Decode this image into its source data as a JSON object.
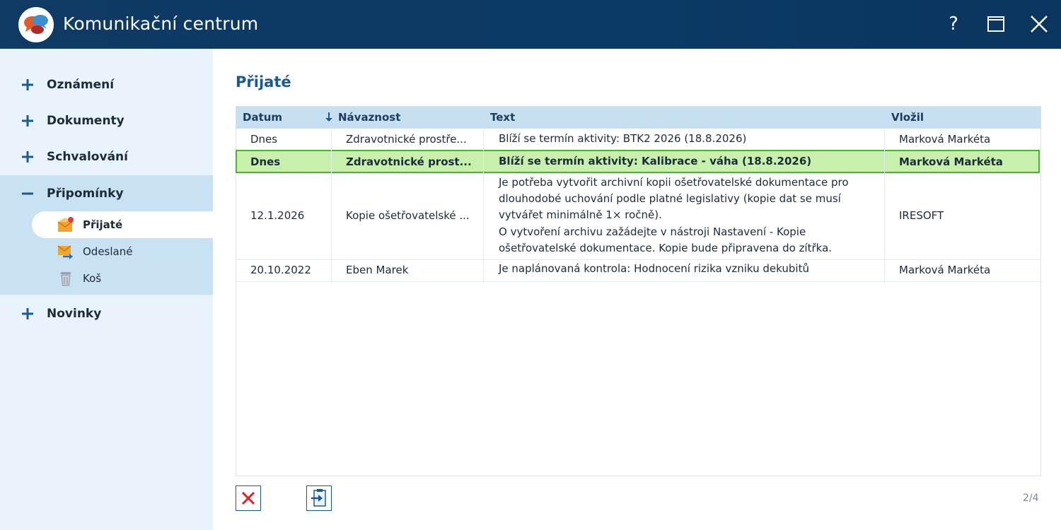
{
  "window": {
    "title": "Komunikační centrum"
  },
  "titlebar": {
    "help_label": "?"
  },
  "sidebar": {
    "items": [
      {
        "label": "Oznámení",
        "state": "collapsed"
      },
      {
        "label": "Dokumenty",
        "state": "collapsed"
      },
      {
        "label": "Schvalování",
        "state": "collapsed"
      },
      {
        "label": "Připomínky",
        "state": "expanded",
        "children": [
          {
            "label": "Přijaté",
            "icon": "envelope-received-icon",
            "active": true
          },
          {
            "label": "Odeslané",
            "icon": "envelope-sent-icon",
            "active": false
          },
          {
            "label": "Koš",
            "icon": "trash-icon",
            "active": false
          }
        ]
      },
      {
        "label": "Novinky",
        "state": "collapsed"
      }
    ]
  },
  "main": {
    "title": "Přijaté",
    "table": {
      "columns": [
        "Datum",
        "Návaznost",
        "Text",
        "Vložil"
      ],
      "sort_column": "Datum",
      "sort_direction": "descending",
      "rows": [
        {
          "datum": "Dnes",
          "navaznost": "Zdravotnické prostře...",
          "text": [
            "Blíží se termín aktivity: BTK2 2026 (18.8.2026)"
          ],
          "vlozil": "Marková Markéta",
          "selected": false
        },
        {
          "datum": "Dnes",
          "navaznost": "Zdravotnické prost...",
          "text": [
            "Blíží se termín aktivity: Kalibrace - váha (18.8.2026)"
          ],
          "vlozil": "Marková Markéta",
          "selected": true
        },
        {
          "datum": "12.1.2026",
          "navaznost": "Kopie ošetřovatelské ...",
          "text": [
            "Je potřeba vytvořit archivní kopii ošetřovatelské dokumentace pro",
            "dlouhodobé uchování podle platné legislativy (kopie dat se musí",
            "vytvářet minimálně 1× ročně).",
            "O vytvoření archivu zažádejte v nástroji Nastavení - Kopie",
            "ošetřovatelské dokumentace. Kopie bude připravena do zítřka."
          ],
          "vlozil": "IRESOFT",
          "selected": false
        },
        {
          "datum": "20.10.2022",
          "navaznost": "Eben Marek",
          "text": [
            "Je naplánovaná kontrola: Hodnocení rizika vzniku dekubitů"
          ],
          "vlozil": "Marková Markéta",
          "selected": false
        }
      ]
    },
    "pager": "2/4"
  },
  "colors": {
    "titlebar": "#0b3a66",
    "accent": "#1a5a8e",
    "selected_row": "#c7f0ad",
    "selected_border": "#4cb030",
    "delete_red": "#e02020"
  }
}
